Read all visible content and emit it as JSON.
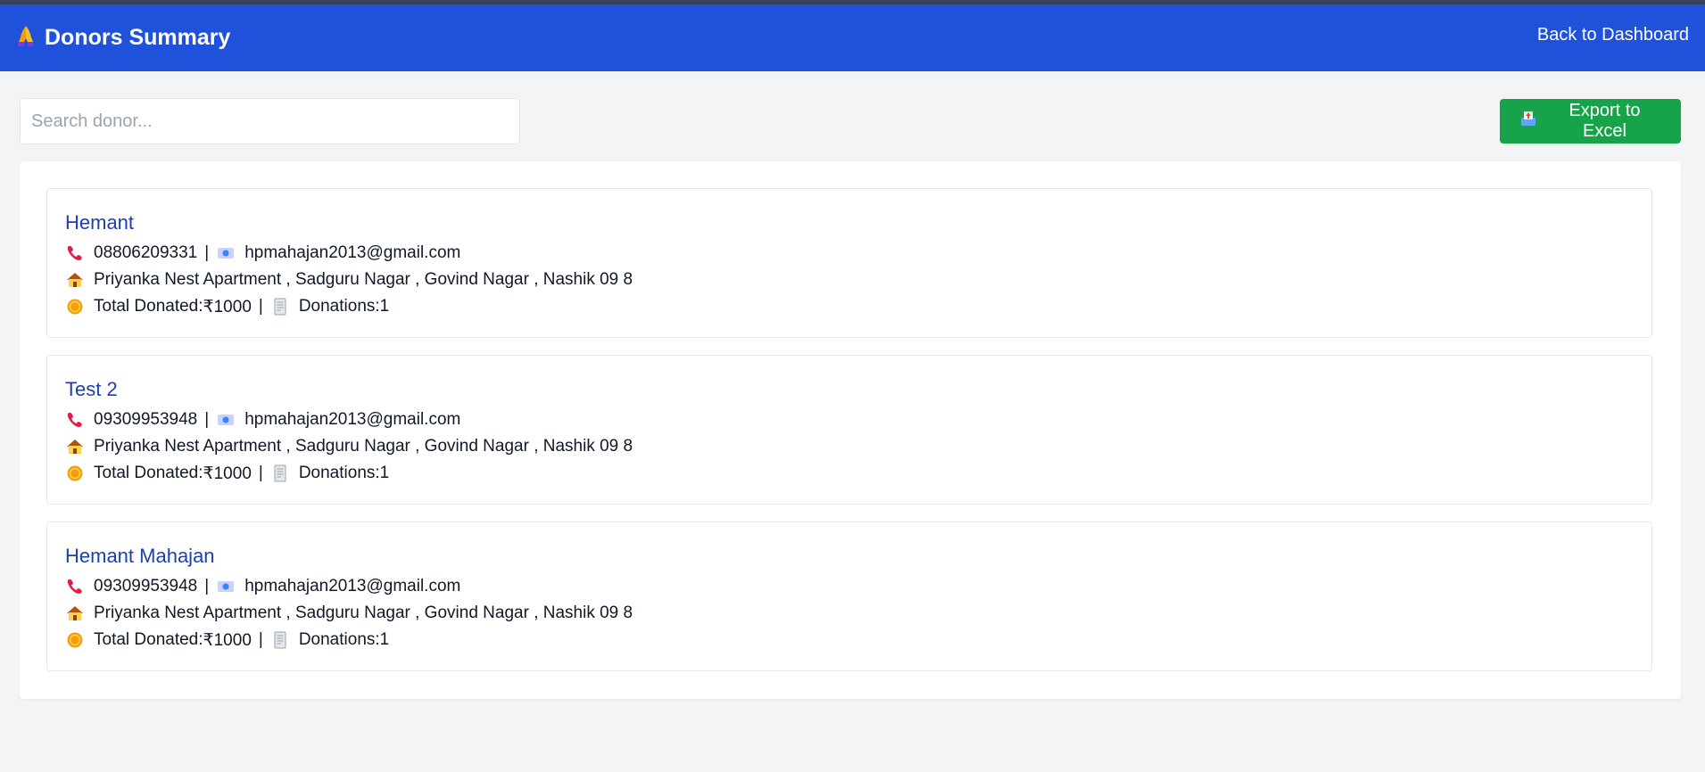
{
  "header": {
    "title": "Donors Summary",
    "back_link": "Back to Dashboard",
    "brand_color": "#1f51db"
  },
  "toolbar": {
    "search_placeholder": "Search donor...",
    "export_label": "Export to Excel",
    "export_color": "#16a34a"
  },
  "labels": {
    "separator": "|",
    "total_donated_prefix": "Total Donated: ",
    "donations_prefix": "Donations: "
  },
  "donors": [
    {
      "name": "Hemant",
      "phone": "08806209331",
      "email": "hpmahajan2013@gmail.com",
      "address": "Priyanka Nest Apartment , Sadguru Nagar , Govind Nagar , Nashik 09 8",
      "total_donated": "₹1000",
      "donations": "1"
    },
    {
      "name": "Test 2",
      "phone": "09309953948",
      "email": "hpmahajan2013@gmail.com",
      "address": "Priyanka Nest Apartment , Sadguru Nagar , Govind Nagar , Nashik 09 8",
      "total_donated": "₹1000",
      "donations": "1"
    },
    {
      "name": "Hemant Mahajan",
      "phone": "09309953948",
      "email": "hpmahajan2013@gmail.com",
      "address": "Priyanka Nest Apartment , Sadguru Nagar , Govind Nagar , Nashik 09 8",
      "total_donated": "₹1000",
      "donations": "1"
    }
  ],
  "icons": {
    "brand": "praying-hands-icon",
    "export": "outbox-tray-icon",
    "phone": "telephone-receiver-icon",
    "email": "id-card-icon",
    "address": "house-icon",
    "amount": "coin-icon",
    "donations": "receipt-icon"
  }
}
